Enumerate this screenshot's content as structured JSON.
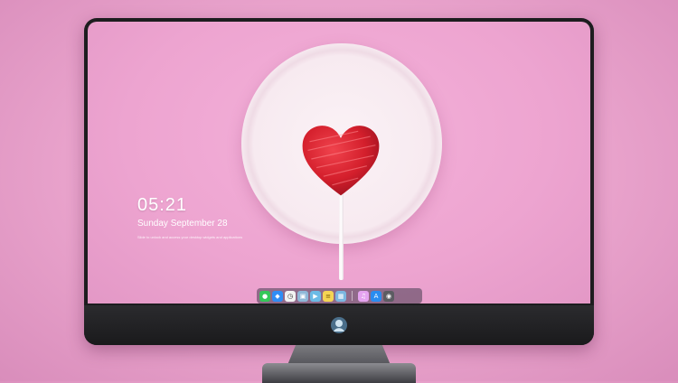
{
  "lock_screen": {
    "time": "05:21",
    "date": "Sunday September  28",
    "subline": "Slide to unlock and access your desktop widgets and applications"
  },
  "dock": {
    "apps": [
      {
        "icon": "messages-icon",
        "glyph": "●",
        "color": "#34c759"
      },
      {
        "icon": "finder-icon",
        "glyph": "◆",
        "color": "#2f8df5"
      },
      {
        "icon": "clock-app-icon",
        "glyph": "◷",
        "color": "#f2f2f2"
      },
      {
        "icon": "preview-icon",
        "glyph": "▣",
        "color": "#8fb8d8"
      },
      {
        "icon": "movie-icon",
        "glyph": "▶",
        "color": "#6bbbe6"
      },
      {
        "icon": "notes-icon",
        "glyph": "≡",
        "color": "#f5d454"
      },
      {
        "icon": "photos-icon",
        "glyph": "▦",
        "color": "#7bb6e0"
      },
      {
        "icon": "itunes-icon",
        "glyph": "♫",
        "color": "#e5a3f0"
      },
      {
        "icon": "app-store-icon",
        "glyph": "A",
        "color": "#2a8cf0"
      },
      {
        "icon": "camera-icon",
        "glyph": "◉",
        "color": "#5c5c62"
      }
    ]
  },
  "colors": {
    "wallpaper": "#eda4d0",
    "heart": "#d4202d",
    "bezel": "#1d1d1f"
  }
}
